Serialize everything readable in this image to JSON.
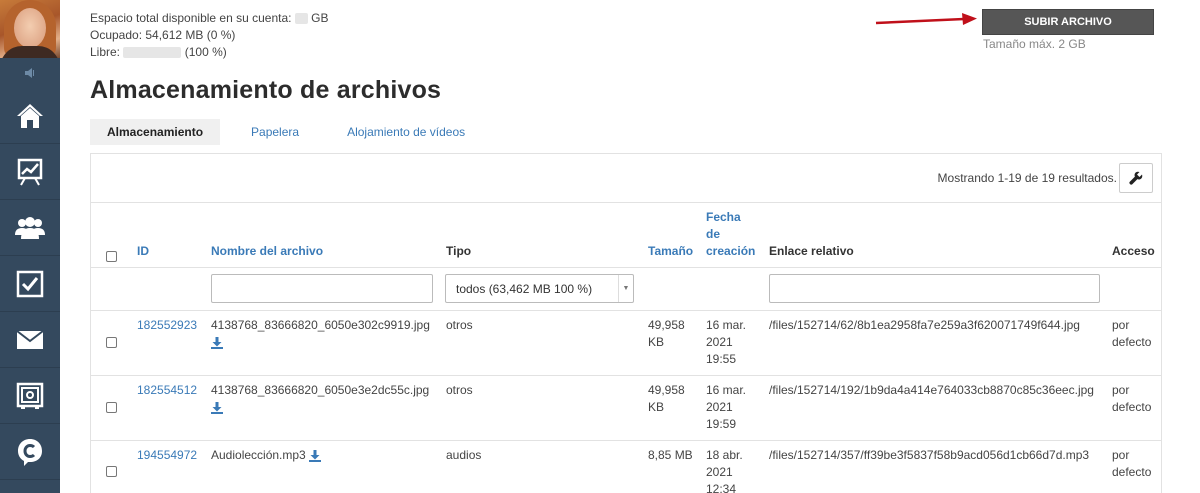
{
  "sidebar": {
    "items": [
      {
        "name": "home-icon"
      },
      {
        "name": "chart-icon"
      },
      {
        "name": "users-icon"
      },
      {
        "name": "tasks-icon"
      },
      {
        "name": "mail-icon"
      },
      {
        "name": "storage-icon"
      },
      {
        "name": "chat-icon"
      }
    ]
  },
  "quota": {
    "total_label": "Espacio total disponible en su cuenta:",
    "total_unit": "GB",
    "used": "Ocupado: 54,612 MB (0 %)",
    "free_label": "Libre:",
    "free_pct": "(100 %)"
  },
  "upload": {
    "button_label": "SUBIR ARCHIVO",
    "max_size": "Tamaño máx. 2 GB"
  },
  "page_title": "Almacenamiento de archivos",
  "tabs": [
    {
      "label": "Almacenamiento",
      "active": true
    },
    {
      "label": "Papelera",
      "active": false
    },
    {
      "label": "Alojamiento de vídeos",
      "active": false
    }
  ],
  "results_text": "Mostrando 1-19 de 19 resultados.",
  "columns": {
    "id": "ID",
    "name": "Nombre del archivo",
    "type": "Tipo",
    "size": "Tamaño",
    "date_1": "Fecha",
    "date_2": "de",
    "date_3": "creación",
    "link": "Enlace relativo",
    "access": "Acceso"
  },
  "filters": {
    "type_selected": "todos (63,462 MB 100 %)"
  },
  "rows": [
    {
      "id": "182552923",
      "name": "4138768_83666820_6050e302c9919.jpg",
      "type": "otros",
      "size_1": "49,958",
      "size_2": "KB",
      "date_1": "16 mar.",
      "date_2": "2021",
      "date_3": "19:55",
      "link": "/files/152714/62/8b1ea2958fa7e259a3f620071749f644.jpg",
      "access_1": "por",
      "access_2": "defecto"
    },
    {
      "id": "182554512",
      "name": "4138768_83666820_6050e3e2dc55c.jpg",
      "type": "otros",
      "size_1": "49,958",
      "size_2": "KB",
      "date_1": "16 mar.",
      "date_2": "2021",
      "date_3": "19:59",
      "link": "/files/152714/192/1b9da4a414e764033cb8870c85c36eec.jpg",
      "access_1": "por",
      "access_2": "defecto"
    },
    {
      "id": "194554972",
      "name": "Audiolección.mp3",
      "type": "audios",
      "size_1": "8,85 MB",
      "size_2": "",
      "date_1": "18 abr.",
      "date_2": "2021",
      "date_3": "12:34",
      "link": "/files/152714/357/ff39be3f5837f58b9acd056d1cb66d7d.mp3",
      "access_1": "por",
      "access_2": "defecto"
    }
  ],
  "colors": {
    "sidebar": "#34495e",
    "link": "#3a7ab7",
    "button": "#565656",
    "arrow": "#c0101a"
  }
}
